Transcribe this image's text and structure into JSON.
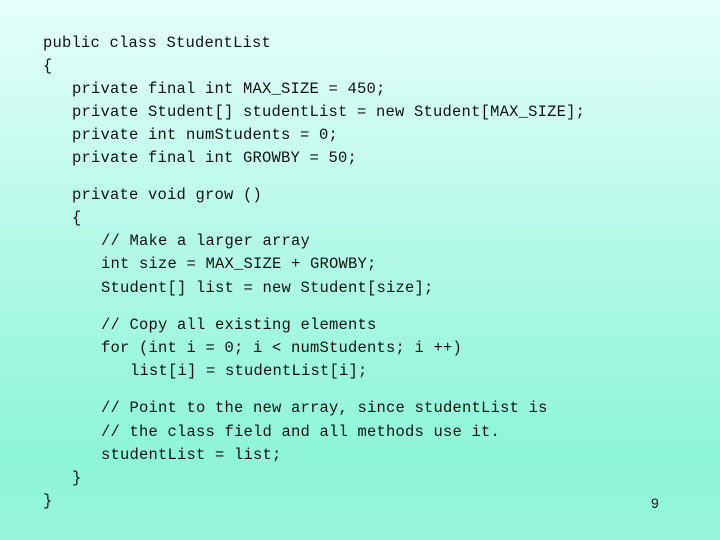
{
  "slide": {
    "code_lines": [
      "public class StudentList",
      "{",
      "private final int MAX_SIZE = 450;",
      "private Student[] studentList = new Student[MAX_SIZE];",
      "private int numStudents = 0;",
      "private final int GROWBY = 50;",
      "private void grow ()",
      "{",
      "// Make a larger array",
      "int size = MAX_SIZE + GROWBY;",
      "Student[] list = new Student[size];",
      "// Copy all existing elements",
      "for (int i = 0; i < numStudents; i ++)",
      "list[i] = studentList[i];",
      "// Point to the new array, since studentList is",
      "// the class field and all methods use it.",
      "studentList = list;",
      "}",
      "}"
    ],
    "page_number": "9"
  }
}
